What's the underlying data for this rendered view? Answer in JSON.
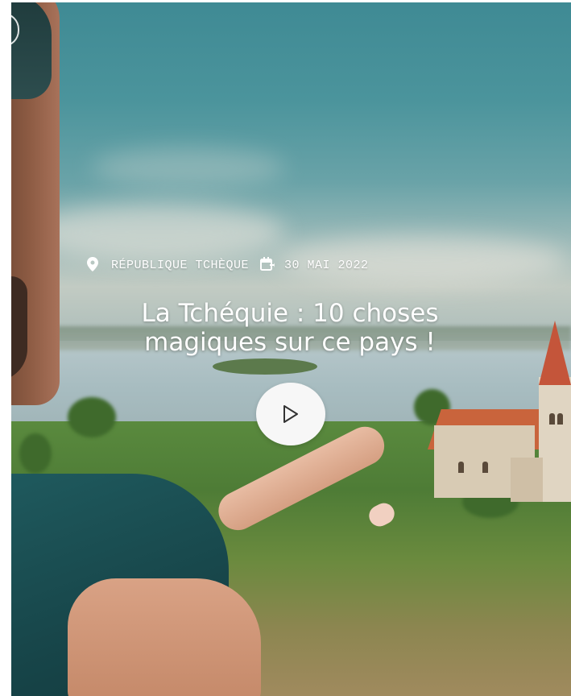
{
  "hero": {
    "location": "RÉPUBLIQUE TCHÈQUE",
    "date": "30 MAI 2022",
    "title_line1": "La Tchéquie : 10 choses",
    "title_line2": "magiques sur ce pays !"
  },
  "icons": {
    "location": "map-pin-icon",
    "date": "calendar-icon",
    "play": "play-icon"
  },
  "colors": {
    "text": "#ffffff",
    "play_button_bg": "#f7f7f7",
    "play_icon": "#333333"
  }
}
